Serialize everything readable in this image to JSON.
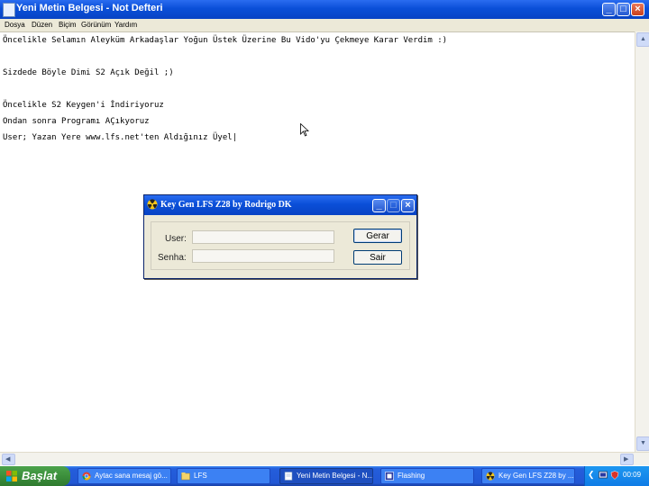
{
  "notepad": {
    "title": "Yeni Metin Belgesi - Not Defteri",
    "menu": [
      "Dosya",
      "Düzen",
      "Biçim",
      "Görünüm",
      "Yardım"
    ],
    "lines": [
      "Öncelikle Selamın Aleyküm Arkadaşlar Yoğun Üstek Üzerine Bu Vido'yu Çekmeye Karar Verdim :)",
      "",
      "Sizdede Böyle Dimi S2 Açık Değil ;)",
      "",
      "Öncelikle S2 Keygen'i İndiriyoruz",
      "Ondan sonra Programı AÇıkyoruz",
      "User; Yazan Yere www.lfs.net'ten Aldığınız Üyel|"
    ]
  },
  "keygen": {
    "title": "Key Gen LFS Z28 by Rodrigo DK",
    "user_label": "User:",
    "senha_label": "Senha:",
    "user_value": "",
    "senha_value": "",
    "gerar_label": "Gerar",
    "sair_label": "Sair"
  },
  "taskbar": {
    "start_label": "Başlat",
    "items": [
      {
        "label": "Aytac sana mesaj gö...",
        "icon": "chrome-icon"
      },
      {
        "label": "LFS",
        "icon": "folder-icon"
      },
      {
        "label": "Yeni Metin Belgesi - N...",
        "icon": "notepad-icon"
      },
      {
        "label": "Flashing",
        "icon": "app-icon"
      },
      {
        "label": "Key Gen LFS Z28 by ...",
        "icon": "keygen-icon"
      }
    ],
    "clock": "00:09"
  }
}
